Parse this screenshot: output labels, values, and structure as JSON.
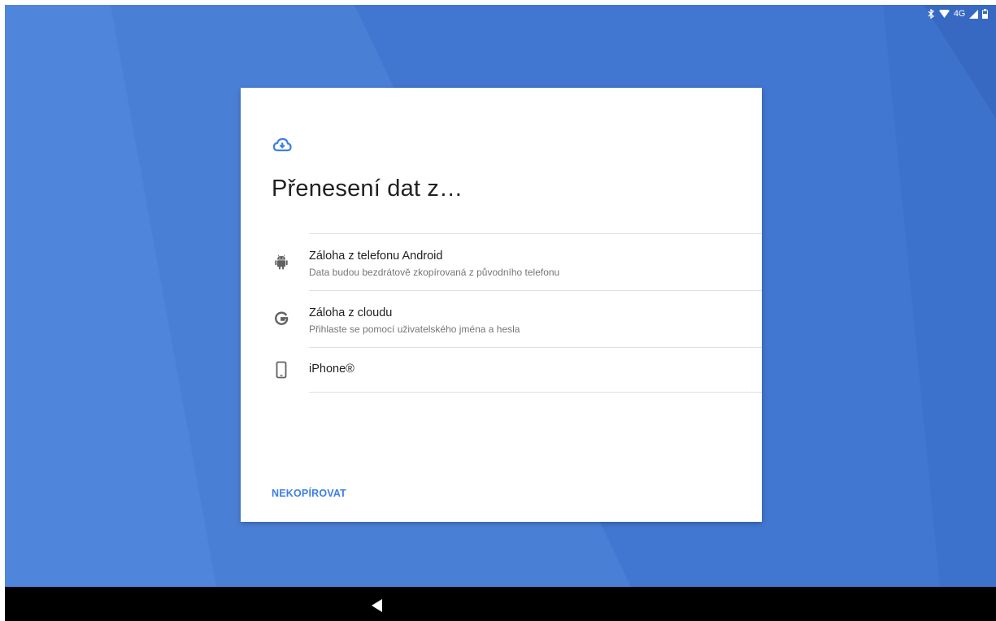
{
  "status_bar": {
    "network": "4G",
    "icons": [
      "bluetooth-icon",
      "wifi-icon",
      "signal-icon",
      "battery-icon"
    ]
  },
  "colors": {
    "wallpaper": "#4a7fd6",
    "accent": "#3d7ee8",
    "card": "#ffffff",
    "nav_bar": "#000000"
  },
  "dialog": {
    "header_icon": "cloud-download-icon",
    "title": "Přenesení dat z…",
    "options": [
      {
        "icon": "android-icon",
        "title": "Záloha z telefonu Android",
        "subtitle": "Data budou bezdrátově zkopírovaná z původního telefonu"
      },
      {
        "icon": "google-icon",
        "title": "Záloha z cloudu",
        "subtitle": "Přihlaste se pomocí uživatelského jména a hesla"
      },
      {
        "icon": "phone-icon",
        "title": "iPhone®"
      }
    ],
    "skip_label": "NEKOPÍROVAT"
  },
  "nav_bar": {
    "back_icon": "back-icon"
  }
}
